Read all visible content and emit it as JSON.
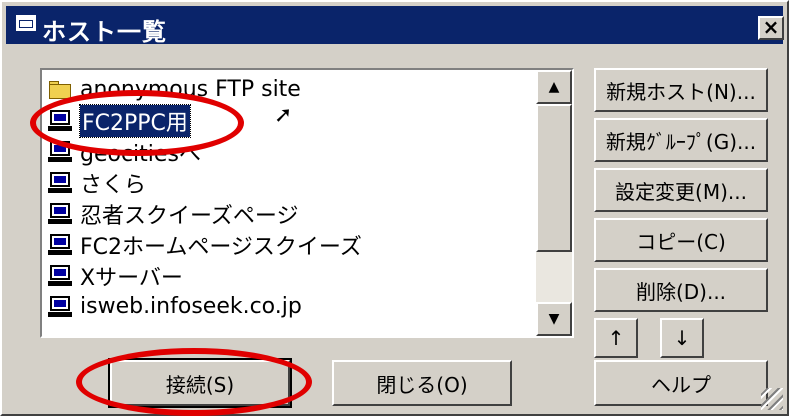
{
  "window": {
    "title": "ホスト一覧",
    "close_label": "×"
  },
  "host_list": {
    "items": [
      {
        "label": "anonymous FTP site",
        "icon": "folder-icon",
        "selected": false
      },
      {
        "label": "FC2PPC用",
        "icon": "pc-icon",
        "selected": true
      },
      {
        "label": "geocitiesへ",
        "icon": "pc-icon",
        "selected": false
      },
      {
        "label": "さくら",
        "icon": "pc-icon",
        "selected": false
      },
      {
        "label": "忍者スクイーズページ",
        "icon": "pc-icon",
        "selected": false
      },
      {
        "label": "FC2ホームページスクイーズ",
        "icon": "pc-icon",
        "selected": false
      },
      {
        "label": "Xサーバー",
        "icon": "pc-icon",
        "selected": false
      },
      {
        "label": "isweb.infoseek.co.jp",
        "icon": "pc-icon",
        "selected": false
      }
    ]
  },
  "scrollbar": {
    "up": "▲",
    "down": "▼"
  },
  "side_buttons": {
    "new_host": "新規ホスト(N)...",
    "new_group": "新規ｸﾞﾙｰﾌﾟ(G)...",
    "settings": "設定変更(M)...",
    "copy": "コピー(C)",
    "delete": "削除(D)...",
    "move_up": "↑",
    "move_down": "↓",
    "help": "ヘルプ"
  },
  "bottom_buttons": {
    "connect": "接続(S)",
    "close": "閉じる(O)"
  },
  "highlight_color": "#e00000"
}
